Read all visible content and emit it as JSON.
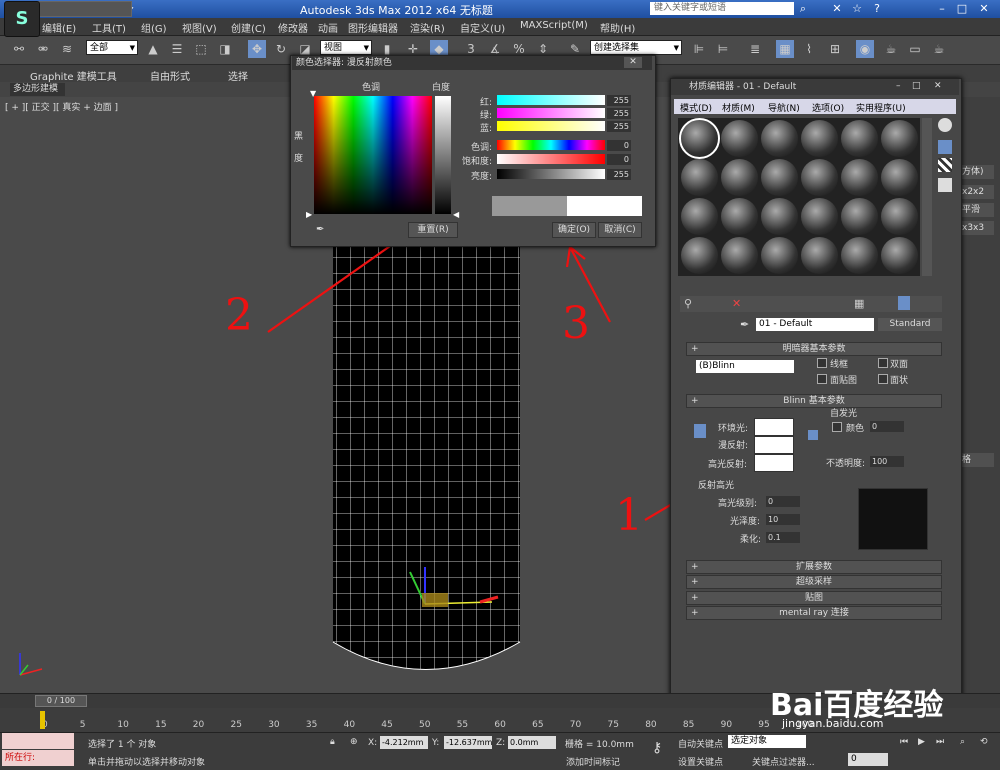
{
  "titlebar": {
    "title": "Autodesk 3ds Max  2012 x64      无标题",
    "search_placeholder": "键入关键字或短语",
    "logo": "app-logo-icon"
  },
  "menu": [
    "编辑(E)",
    "工具(T)",
    "组(G)",
    "视图(V)",
    "创建(C)",
    "修改器",
    "动画",
    "图形编辑器",
    "渲染(R)",
    "自定义(U)",
    "MAXScript(M)",
    "帮助(H)"
  ],
  "toolbar": {
    "filter_value": "全部",
    "view_value": "视图",
    "selection_set": "创建选择集"
  },
  "ribbon": {
    "tabs": [
      "Graphite 建模工具",
      "自由形式",
      "选择"
    ],
    "sub": "多边形建模"
  },
  "viewport": {
    "label": "[ + ][ 正交 ][ 真实 + 边面 ]"
  },
  "color_dialog": {
    "title": "颜色选择器: 漫反射颜色",
    "hue_label": "色调",
    "whiteness_label": "白度",
    "blackness_label": "黑度",
    "channels": [
      {
        "label": "红:",
        "value": "255"
      },
      {
        "label": "绿:",
        "value": "255"
      },
      {
        "label": "蓝:",
        "value": "255"
      },
      {
        "label": "色调:",
        "value": "0"
      },
      {
        "label": "饱和度:",
        "value": "0"
      },
      {
        "label": "亮度:",
        "value": "255"
      }
    ],
    "reset_button": "重置(R)",
    "ok_button": "确定(O)",
    "cancel_button": "取消(C)"
  },
  "material_editor": {
    "title": "材质编辑器 - 01 - Default",
    "menu": [
      "模式(D)",
      "材质(M)",
      "导航(N)",
      "选项(O)",
      "实用程序(U)"
    ],
    "material_name": "01 - Default",
    "material_type": "Standard",
    "shader_section": "明暗器基本参数",
    "shader_value": "(B)Blinn",
    "shader_checks": [
      "线框",
      "双面",
      "面贴图",
      "面状"
    ],
    "blinn_section": "Blinn 基本参数",
    "self_illum_label": "自发光",
    "color_label": "颜色",
    "self_illum_value": "0",
    "ambient_label": "环境光:",
    "diffuse_label": "漫反射:",
    "specular_label": "高光反射:",
    "opacity_label": "不透明度:",
    "opacity_value": "100",
    "highlights_label": "反射高光",
    "spec_level_label": "高光级别:",
    "spec_level_value": "0",
    "gloss_label": "光泽度:",
    "gloss_value": "10",
    "soften_label": "柔化:",
    "soften_value": "0.1",
    "rollouts": [
      "扩展参数",
      "超级采样",
      "贴图",
      "mental ray 连接"
    ]
  },
  "command_panel": [
    "方体)",
    "x2x2",
    "平滑",
    "x3x3",
    "格"
  ],
  "timeline": {
    "position": "0 / 100",
    "ticks": [
      "0",
      "5",
      "10",
      "15",
      "20",
      "25",
      "30",
      "35",
      "40",
      "45",
      "50",
      "55",
      "60",
      "65",
      "70",
      "75",
      "80",
      "85",
      "90",
      "95",
      "100"
    ]
  },
  "status": {
    "running": "所在行:",
    "selected": "选择了 1 个 对象",
    "prompt": "单击并拖动以选择并移动对象",
    "x_label": "X:",
    "x": "-4.212mm",
    "y_label": "Y:",
    "y": "-12.637mm",
    "z_label": "Z:",
    "z": "0.0mm",
    "grid": "栅格 = 10.0mm",
    "auto_key": "自动关键点",
    "selected_obj": "选定对象",
    "set_key": "设置关键点",
    "key_filters": "关键点过滤器...",
    "add_time_tag": "添加时间标记",
    "frame": "0"
  },
  "annotations": [
    "1",
    "2",
    "3"
  ],
  "watermark": {
    "brand": "Bai百度经验",
    "url": "jingyan.baidu.com"
  },
  "colors": {
    "annotation": "#e11111",
    "title_blue": "#2a5bb0"
  }
}
